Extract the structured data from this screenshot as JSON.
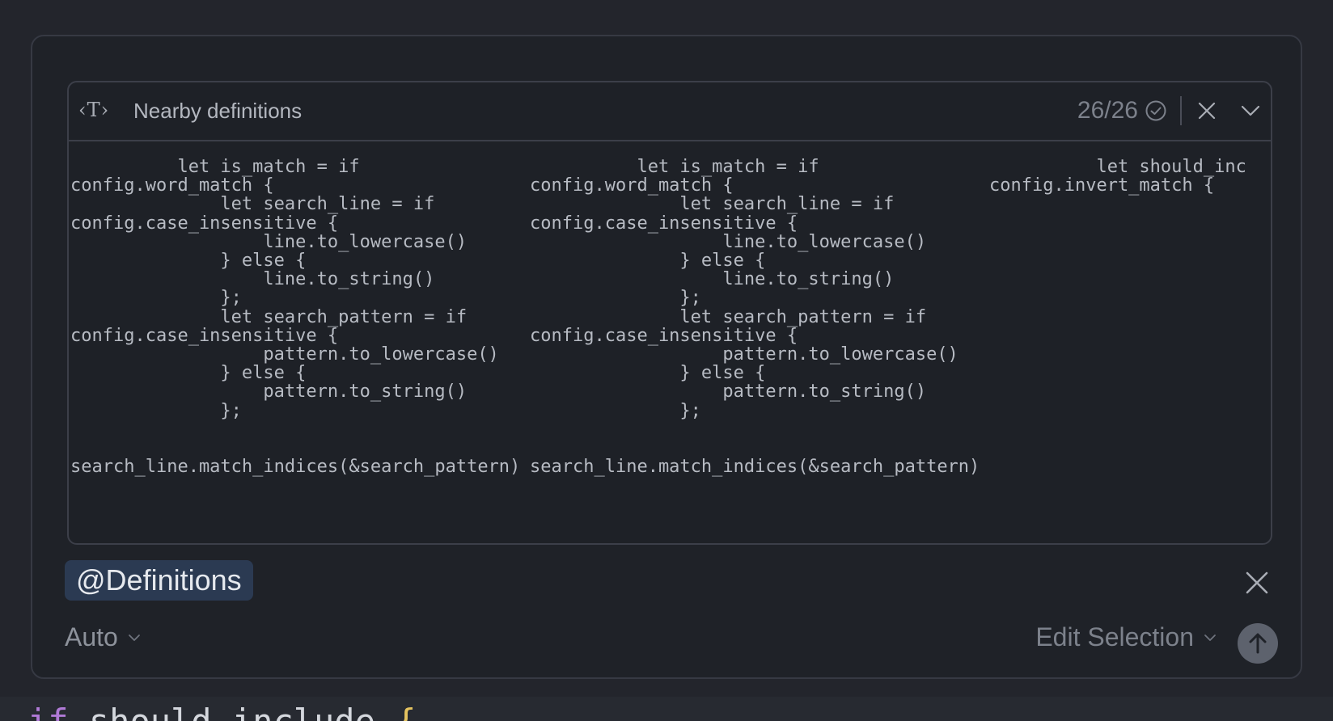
{
  "context_card": {
    "type_icon_glyph": "‹T›",
    "title": "Nearby definitions",
    "counter": "26/26"
  },
  "code_columns": [
    "          let is_match = if\nconfig.word_match {\n              let search_line = if\nconfig.case_insensitive {\n                  line.to_lowercase()\n              } else {\n                  line.to_string()\n              };\n              let search_pattern = if\nconfig.case_insensitive {\n                  pattern.to_lowercase()\n              } else {\n                  pattern.to_string()\n              };\n\n\nsearch_line.match_indices(&search_pattern)",
    "          let is_match = if\nconfig.word_match {\n              let search_line = if\nconfig.case_insensitive {\n                  line.to_lowercase()\n              } else {\n                  line.to_string()\n              };\n              let search_pattern = if\nconfig.case_insensitive {\n                  pattern.to_lowercase()\n              } else {\n                  pattern.to_string()\n              };\n\n\nsearch_line.match_indices(&search_pattern)",
    "          let should_inc\nconfig.invert_match {"
  ],
  "chip": {
    "label": "@Definitions"
  },
  "footer": {
    "mode": "Auto",
    "action": "Edit Selection"
  },
  "editor": {
    "keyword": "if",
    "identifier": "should_include",
    "brace": "{"
  },
  "icons": {
    "type": "text-type-icon",
    "check": "check-circle-icon",
    "close": "close-icon",
    "collapse": "chevron-down-icon",
    "send": "arrow-up-icon"
  }
}
